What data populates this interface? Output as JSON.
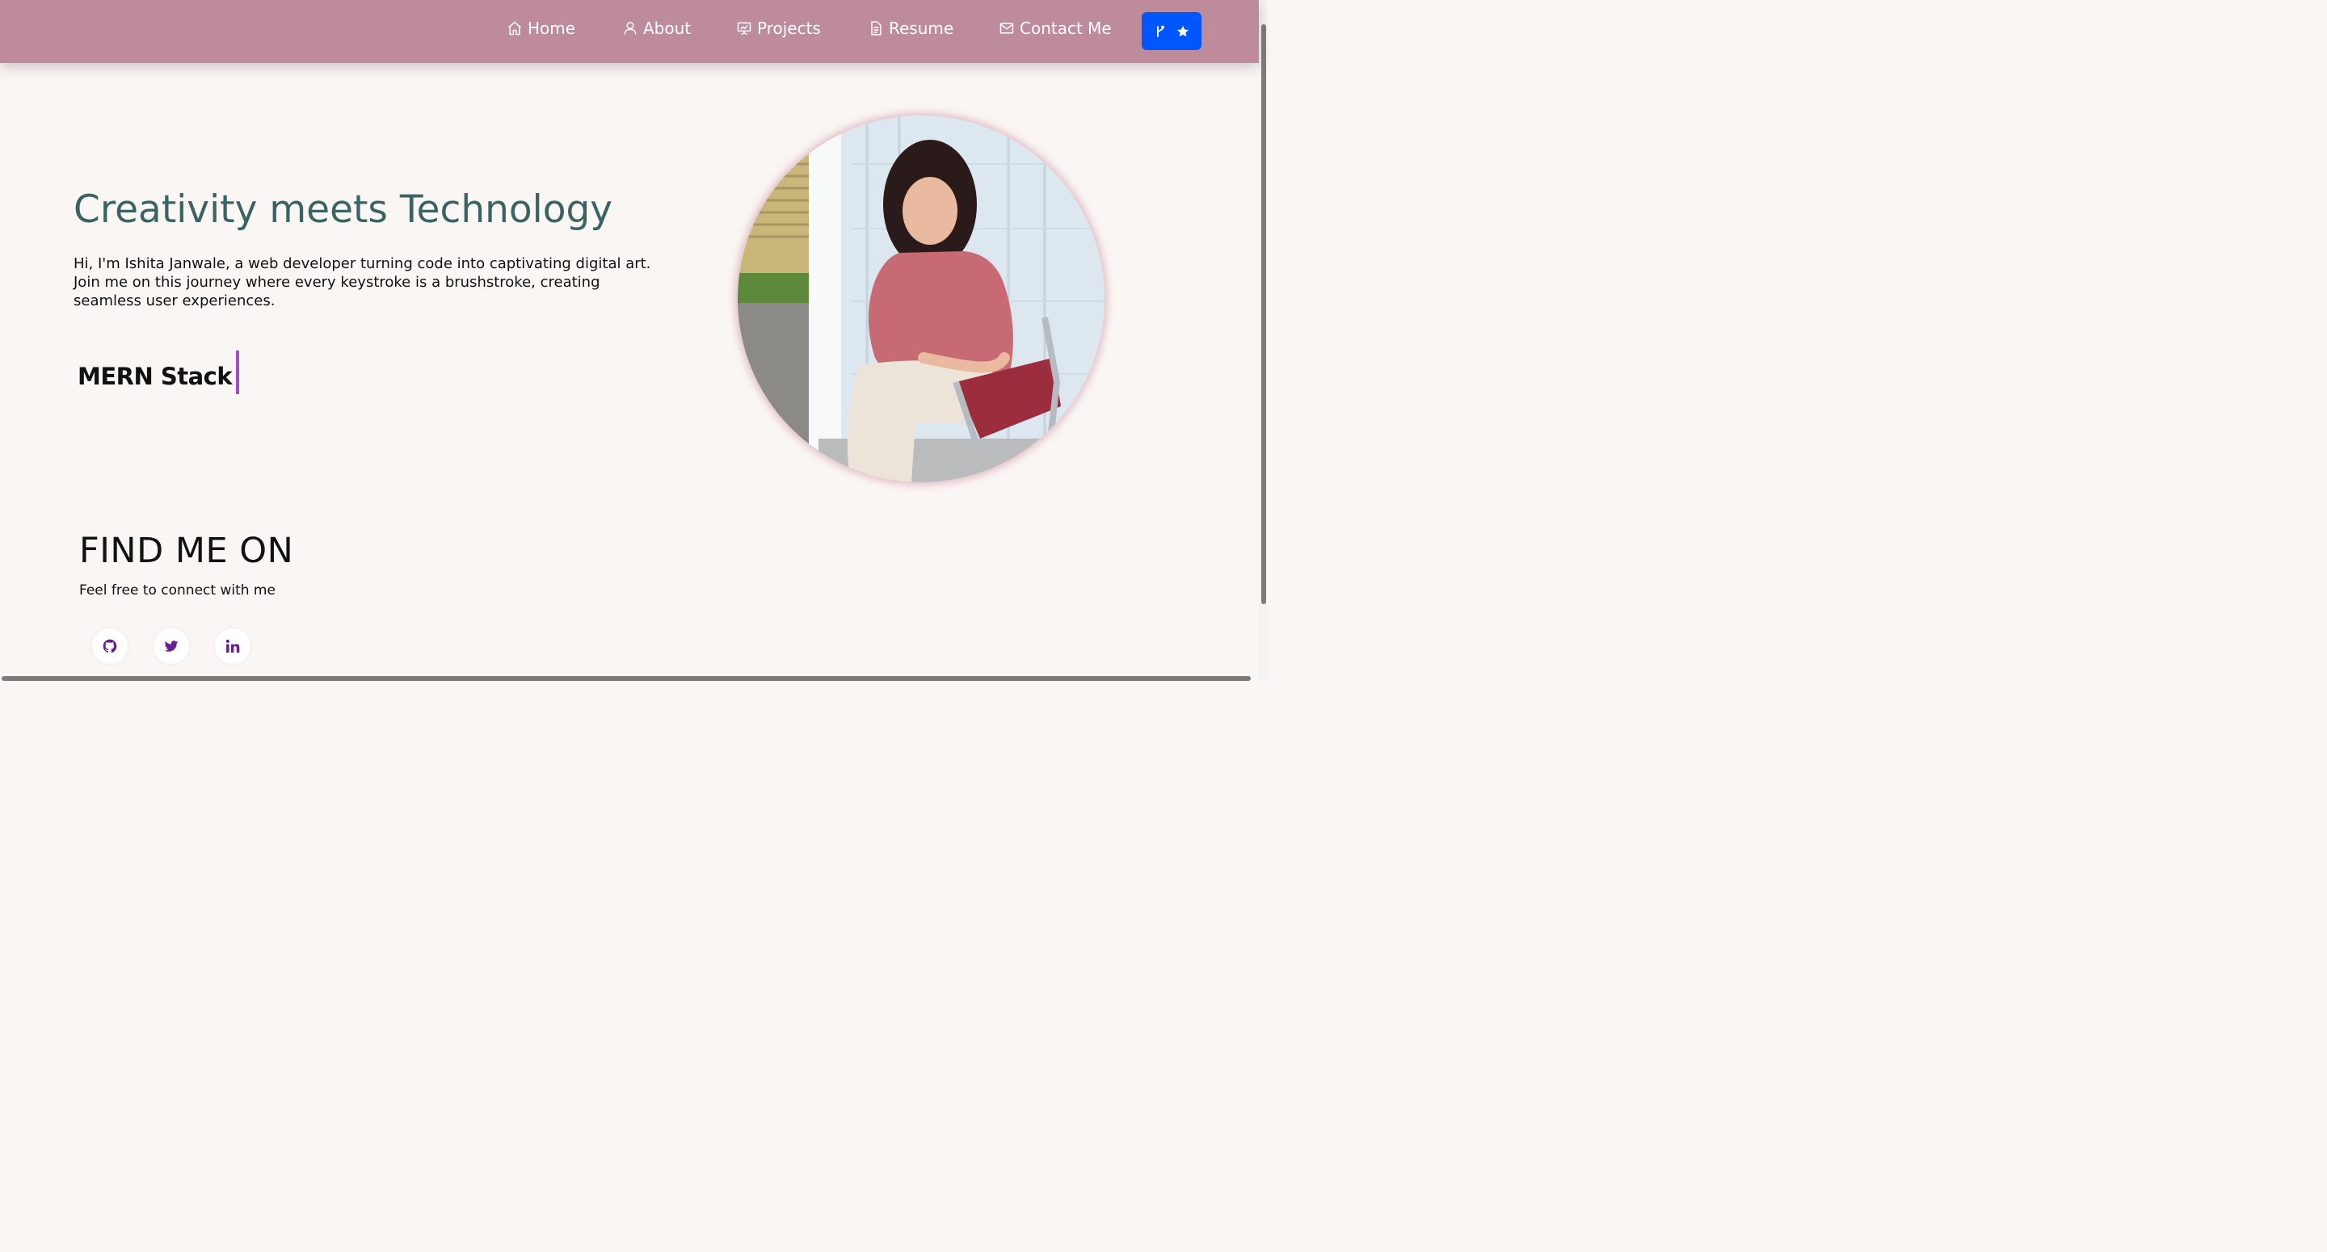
{
  "nav": {
    "items": [
      {
        "label": "Home",
        "icon": "home-icon"
      },
      {
        "label": "About",
        "icon": "user-icon"
      },
      {
        "label": "Projects",
        "icon": "presentation-icon"
      },
      {
        "label": "Resume",
        "icon": "document-icon"
      },
      {
        "label": "Contact Me",
        "icon": "mail-icon"
      }
    ],
    "github_button": {
      "icons": [
        "git-fork-icon",
        "star-icon"
      ],
      "color": "#0057ff"
    }
  },
  "hero": {
    "title": "Creativity meets Technology",
    "intro": "Hi, I'm Ishita Janwale, a web developer turning code into captivating digital art. Join me on this journey where every keystroke is a brushstroke, creating seamless user experiences.",
    "typed_text": "MERN Stack"
  },
  "find": {
    "title": "FIND ME ON",
    "subtitle": "Feel free to connect with me",
    "socials": [
      {
        "icon": "github-icon"
      },
      {
        "icon": "twitter-icon"
      },
      {
        "icon": "linkedin-icon"
      }
    ]
  },
  "colors": {
    "navbar": "#bd8b9b",
    "title": "#3a6463",
    "accent_cursor": "#a24bd0",
    "social_icon": "#6b1f8f",
    "background": "#faf6f4"
  }
}
